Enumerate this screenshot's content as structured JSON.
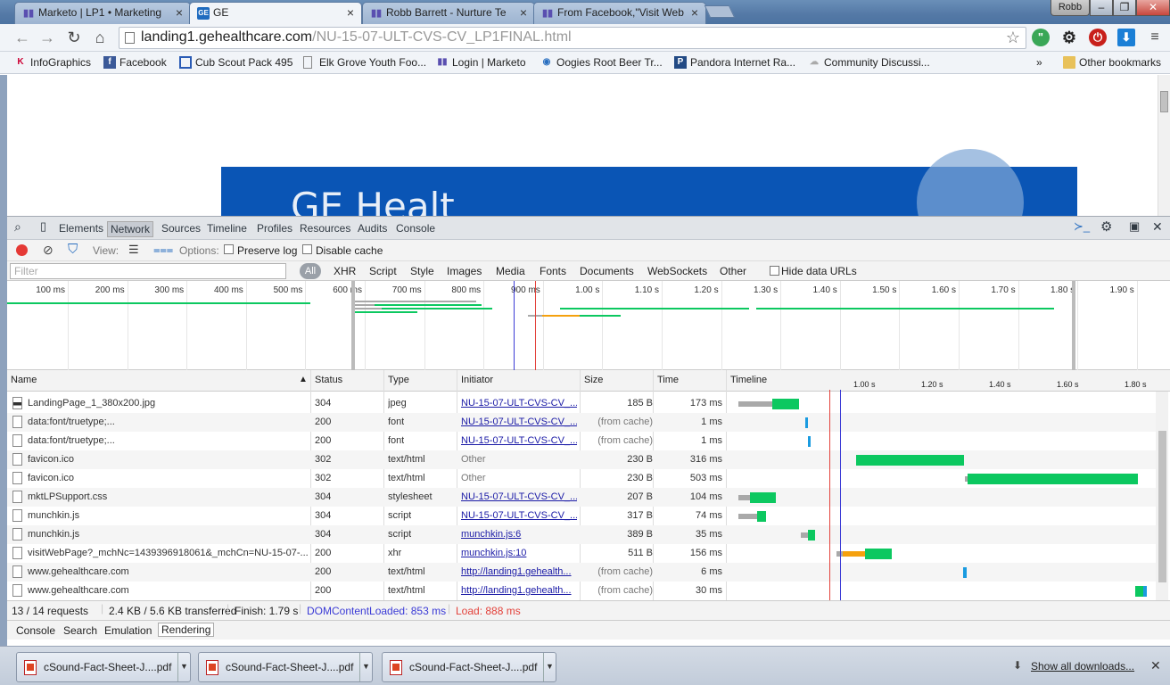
{
  "tabs": [
    {
      "title": "Marketo | LP1 • Marketing",
      "icon": "marketo"
    },
    {
      "title": "GE",
      "icon": "ge"
    },
    {
      "title": "Robb Barrett - Nurture Te",
      "icon": "marketo"
    },
    {
      "title": "From Facebook,\"Visit Web",
      "icon": "marketo"
    }
  ],
  "user": "Robb",
  "url": {
    "host": "landing1.gehealthcare.com",
    "path": "/NU-15-07-ULT-CVS-CV_LP1FINAL.html"
  },
  "bookmarks": [
    "InfoGraphics",
    "Facebook",
    "Cub Scout Pack 495",
    "Elk Grove Youth Foo...",
    "Login | Marketo",
    "Oogies Root Beer Tr...",
    "Pandora Internet Ra...",
    "Community Discussi..."
  ],
  "bookmarks_more": "»",
  "other_bookmarks": "Other bookmarks",
  "page": {
    "banner_text": "GE Healt"
  },
  "devtools": {
    "tabs": [
      "Elements",
      "Network",
      "Sources",
      "Timeline",
      "Profiles",
      "Resources",
      "Audits",
      "Console"
    ],
    "view_label": "View:",
    "options_label": "Options:",
    "preserve_log": "Preserve log",
    "disable_cache": "Disable cache",
    "filter_placeholder": "Filter",
    "filter_all": "All",
    "filter_types": [
      "XHR",
      "Script",
      "Style",
      "Images",
      "Media",
      "Fonts",
      "Documents",
      "WebSockets",
      "Other"
    ],
    "hide_data_urls": "Hide data URLs",
    "overview_ticks": [
      "100 ms",
      "200 ms",
      "300 ms",
      "400 ms",
      "500 ms",
      "600 ms",
      "700 ms",
      "800 ms",
      "900 ms",
      "1.00 s",
      "1.10 s",
      "1.20 s",
      "1.30 s",
      "1.40 s",
      "1.50 s",
      "1.60 s",
      "1.70 s",
      "1.80 s",
      "1.90 s"
    ],
    "columns": [
      "Name",
      "Status",
      "Type",
      "Initiator",
      "Size",
      "Time",
      "Timeline"
    ],
    "timeline_ticks": [
      "1.00 s",
      "1.20 s",
      "1.40 s",
      "1.60 s",
      "1.80 s"
    ],
    "rows": [
      {
        "name": "LandingPage_1_380x200.jpg",
        "status": "304",
        "type": "jpeg",
        "initiator": "NU-15-07-ULT-CVS-CV_...",
        "initiator_link": true,
        "size": "185 B",
        "time": "173 ms"
      },
      {
        "name": "data:font/truetype;...",
        "status": "200",
        "type": "font",
        "initiator": "NU-15-07-ULT-CVS-CV_...",
        "initiator_link": true,
        "size": "(from cache)",
        "time": "1 ms"
      },
      {
        "name": "data:font/truetype;...",
        "status": "200",
        "type": "font",
        "initiator": "NU-15-07-ULT-CVS-CV_...",
        "initiator_link": true,
        "size": "(from cache)",
        "time": "1 ms"
      },
      {
        "name": "favicon.ico",
        "status": "302",
        "type": "text/html",
        "initiator": "Other",
        "initiator_link": false,
        "size": "230 B",
        "time": "316 ms"
      },
      {
        "name": "favicon.ico",
        "status": "302",
        "type": "text/html",
        "initiator": "Other",
        "initiator_link": false,
        "size": "230 B",
        "time": "503 ms"
      },
      {
        "name": "mktLPSupport.css",
        "status": "304",
        "type": "stylesheet",
        "initiator": "NU-15-07-ULT-CVS-CV_...",
        "initiator_link": true,
        "size": "207 B",
        "time": "104 ms"
      },
      {
        "name": "munchkin.js",
        "status": "304",
        "type": "script",
        "initiator": "NU-15-07-ULT-CVS-CV_...",
        "initiator_link": true,
        "size": "317 B",
        "time": "74 ms"
      },
      {
        "name": "munchkin.js",
        "status": "304",
        "type": "script",
        "initiator": "munchkin.js:6",
        "initiator_link": true,
        "size": "389 B",
        "time": "35 ms"
      },
      {
        "name": "visitWebPage?_mchNc=1439396918061&_mchCn=NU-15-07-...",
        "status": "200",
        "type": "xhr",
        "initiator": "munchkin.js:10",
        "initiator_link": true,
        "size": "511 B",
        "time": "156 ms"
      },
      {
        "name": "www.gehealthcare.com",
        "status": "200",
        "type": "text/html",
        "initiator": "http://landing1.gehealth...",
        "initiator_link": true,
        "size": "(from cache)",
        "time": "6 ms"
      },
      {
        "name": "www.gehealthcare.com",
        "status": "200",
        "type": "text/html",
        "initiator": "http://landing1.gehealth...",
        "initiator_link": true,
        "size": "(from cache)",
        "time": "30 ms"
      }
    ],
    "status": {
      "requests": "13 / 14 requests",
      "transferred": "2.4 KB / 5.6 KB transferred",
      "finish": "Finish: 1.79 s",
      "dcl": "DOMContentLoaded: 853 ms",
      "load": "Load: 888 ms"
    },
    "drawer_tabs": [
      "Console",
      "Search",
      "Emulation",
      "Rendering"
    ]
  },
  "downloads": [
    "cSound-Fact-Sheet-J....pdf",
    "cSound-Fact-Sheet-J....pdf",
    "cSound-Fact-Sheet-J....pdf"
  ],
  "show_all_downloads": "Show all downloads...",
  "colors": {
    "dcl_line": "#3b3bd6",
    "load_line": "#e3423b",
    "receive": "#0cc860",
    "waiting": "#a9a9a9"
  }
}
